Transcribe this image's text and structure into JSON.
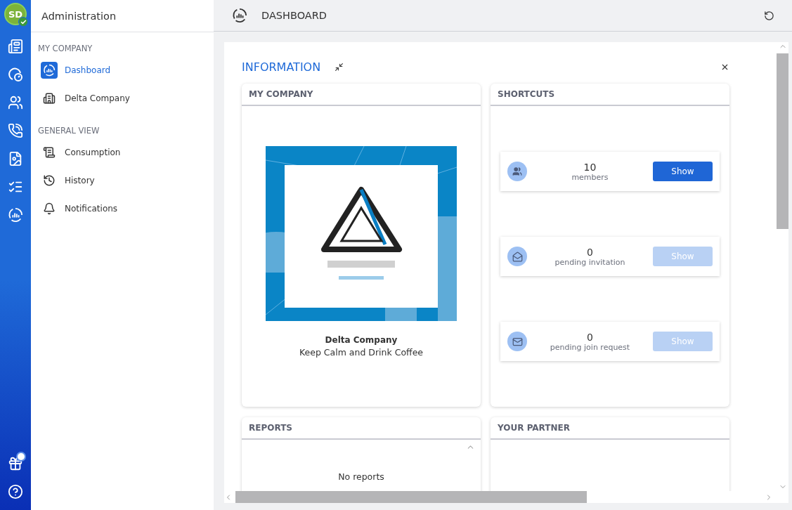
{
  "rail": {
    "avatar": {
      "initials": "SD",
      "verified": true
    },
    "gift": {
      "has_notification": true
    }
  },
  "sidebar": {
    "title": "Administration",
    "sections": [
      {
        "heading": "MY COMPANY",
        "items": [
          {
            "label": "Dashboard",
            "selected": true
          },
          {
            "label": "Delta Company",
            "selected": false
          }
        ]
      },
      {
        "heading": "GENERAL VIEW",
        "items": [
          {
            "label": "Consumption",
            "selected": false
          },
          {
            "label": "History",
            "selected": false
          },
          {
            "label": "Notifications",
            "selected": false
          }
        ]
      }
    ]
  },
  "header": {
    "title": "DASHBOARD"
  },
  "section": {
    "title": "INFORMATION"
  },
  "my_company": {
    "title": "MY COMPANY",
    "name": "Delta Company",
    "tagline": "Keep Calm and Drink Coffee"
  },
  "shortcuts": {
    "title": "SHORTCUTS",
    "items": [
      {
        "count": "10",
        "label": "members",
        "button": "Show",
        "disabled": false
      },
      {
        "count": "0",
        "label": "pending invitation",
        "button": "Show",
        "disabled": true
      },
      {
        "count": "0",
        "label": "pending join request",
        "button": "Show",
        "disabled": true
      }
    ]
  },
  "reports": {
    "title": "REPORTS",
    "empty": "No reports"
  },
  "partner": {
    "title": "YOUR PARTNER"
  }
}
